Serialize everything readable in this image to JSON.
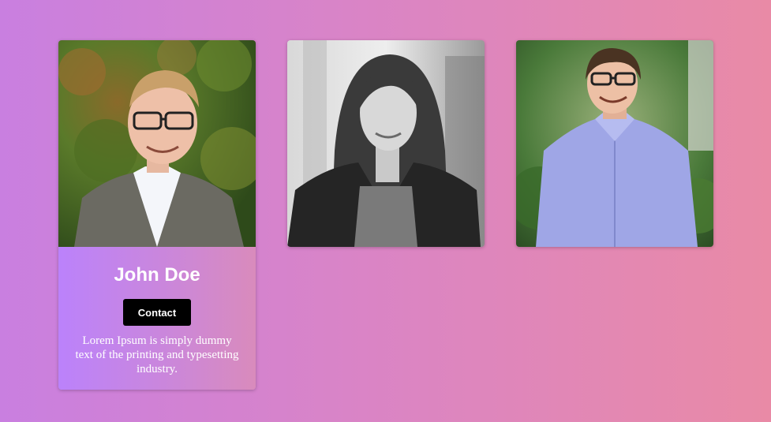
{
  "cards": [
    {
      "name": "John Doe",
      "button_label": "Contact",
      "description": "Lorem Ipsum is simply dummy text of the printing and typesetting industry."
    },
    {},
    {}
  ],
  "colors": {
    "background_start": "#c97fe0",
    "background_end": "#e98aa6",
    "card_details_start": "#bb82fb",
    "card_details_end": "#d98bbc",
    "button_bg": "#000000",
    "text": "#ffffff"
  }
}
